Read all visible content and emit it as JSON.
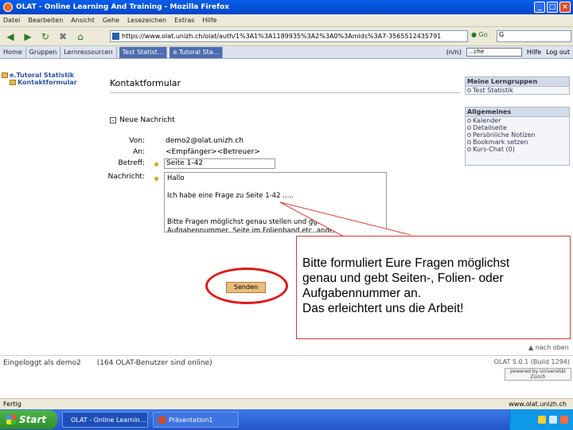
{
  "window": {
    "title": "OLAT - Online Learning And Training - Mozilla Firefox"
  },
  "menubar": [
    "Datei",
    "Bearbeiten",
    "Ansicht",
    "Gehe",
    "Lesezeichen",
    "Extras",
    "Hilfe"
  ],
  "navbar": {
    "url": "https://www.olat.unizh.ch/olat/auth/1%3A1%3A1189935%3A2%3A0%3Amids%3A7-3565512435791",
    "go_label": "Go",
    "search_value": "G"
  },
  "olat": {
    "tabs": [
      "Home",
      "Gruppen",
      "Lernressourcen",
      "Test Statist...",
      "e.Tutoral Sta..."
    ],
    "right_links": {
      "print": "(n/n)",
      "search_placeholder": "...che",
      "help": "Hilfe",
      "logout": "Log out"
    },
    "leftnav": {
      "course": "e.Tutoral Statistik",
      "node": "Kontaktformular"
    },
    "content_title": "Kontaktformular",
    "section": "Neue Nachricht",
    "form": {
      "from_label": "Von:",
      "from_value": "demo2@olat.unizh.ch",
      "to_label": "An:",
      "to_value": "<Empfänger><Betreuer>",
      "subject_label": "Betreff:",
      "subject_value": "Seite 1-42",
      "message_label": "Nachricht:",
      "message_value": "Hallo\n\nIch habe eine Frage zu Seite 1-42 .....\n\n\nBitte Fragen möglichst genau stellen und ggf. Seite,\nAufgabennummer, Seite im Folienband etc. angeben.",
      "submit_label": "Senden"
    },
    "sidebox_groups": {
      "title": "Meine Lerngruppen",
      "items": [
        "Test Statistik"
      ]
    },
    "sidebox_general": {
      "title": "Allgemeines",
      "items": [
        "Kalender",
        "Detailseite",
        "Persönliche Notizen",
        "Bookmark setzen",
        "Kurs-Chat (0)"
      ]
    },
    "top_link": "nach oben",
    "status": {
      "login": "Eingeloggt als demo2",
      "users_online": "(164 OLAT-Benutzer sind online)",
      "version": "OLAT 5.0.1 (Build 1294)"
    },
    "uzh_label": "powered by Universität Zürich"
  },
  "callout": {
    "lines": [
      "Bitte formuliert Eure Fragen möglichst",
      "genau und gebt Seiten-, Folien- oder",
      "Aufgabennummer an.",
      "Das erleichtert uns die Arbeit!"
    ],
    "border_color": "#d23a3a",
    "ellipse_color": "#e01818"
  },
  "ffstatus": {
    "left": "Fertig",
    "right": "www.olat.unizh.ch"
  },
  "taskbar": {
    "start": "Start",
    "tasks": [
      "OLAT - Online Learnin...",
      "Präsentation1"
    ]
  }
}
